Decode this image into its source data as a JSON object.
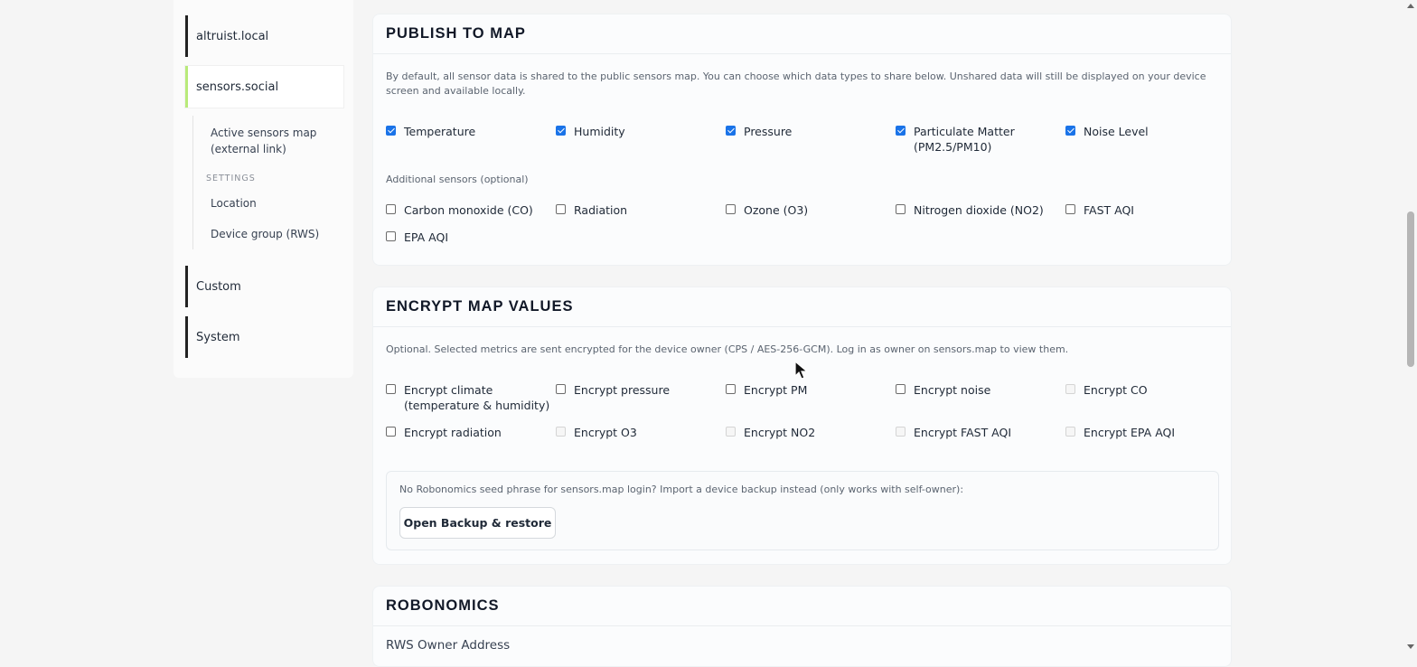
{
  "sidebar": {
    "items": [
      {
        "label": "altruist.local"
      },
      {
        "label": "sensors.social"
      },
      {
        "label": "Custom"
      },
      {
        "label": "System"
      }
    ],
    "sub": {
      "active_map_line1": "Active sensors map",
      "active_map_line2": "(external link)",
      "settings_heading": "SETTINGS",
      "location": "Location",
      "device_group": "Device group (RWS)"
    }
  },
  "publish": {
    "title": "PUBLISH TO MAP",
    "description": "By default, all sensor data is shared to the public sensors map. You can choose which data types to share below. Unshared data will still be displayed on your device screen and available locally.",
    "sensors": [
      {
        "label": "Temperature",
        "checked": true
      },
      {
        "label": "Humidity",
        "checked": true
      },
      {
        "label": "Pressure",
        "checked": true
      },
      {
        "label": "Particulate Matter",
        "label2": "(PM2.5/PM10)",
        "checked": true
      },
      {
        "label": "Noise Level",
        "checked": true
      }
    ],
    "additional_label": "Additional sensors (optional)",
    "additional": [
      {
        "label": "Carbon monoxide (CO)",
        "checked": false
      },
      {
        "label": "Radiation",
        "checked": false
      },
      {
        "label": "Ozone (O3)",
        "checked": false
      },
      {
        "label": "Nitrogen dioxide (NO2)",
        "checked": false
      },
      {
        "label": "FAST AQI",
        "checked": false
      },
      {
        "label": "EPA AQI",
        "checked": false
      }
    ]
  },
  "encrypt": {
    "title": "ENCRYPT MAP VALUES",
    "description": "Optional. Selected metrics are sent encrypted for the device owner (CPS / AES-256-GCM). Log in as owner on sensors.map to view them.",
    "options": [
      {
        "label": "Encrypt climate",
        "label2": "(temperature & humidity)",
        "disabled": false
      },
      {
        "label": "Encrypt pressure",
        "disabled": false
      },
      {
        "label": "Encrypt PM",
        "disabled": false
      },
      {
        "label": "Encrypt noise",
        "disabled": false
      },
      {
        "label": "Encrypt CO",
        "disabled": true
      },
      {
        "label": "Encrypt radiation",
        "disabled": false
      },
      {
        "label": "Encrypt O3",
        "disabled": true
      },
      {
        "label": "Encrypt NO2",
        "disabled": true
      },
      {
        "label": "Encrypt FAST AQI",
        "disabled": true
      },
      {
        "label": "Encrypt EPA AQI",
        "disabled": true
      }
    ],
    "backup_note": "No Robonomics seed phrase for sensors.map login? Import a device backup instead (only works with self-owner):",
    "backup_button": "Open Backup & restore"
  },
  "robonomics": {
    "title": "ROBONOMICS",
    "owner_address_label": "RWS Owner Address"
  },
  "colors": {
    "accent_checkbox": "#1a73e8",
    "active_nav_marker": "#b9ea7a"
  }
}
